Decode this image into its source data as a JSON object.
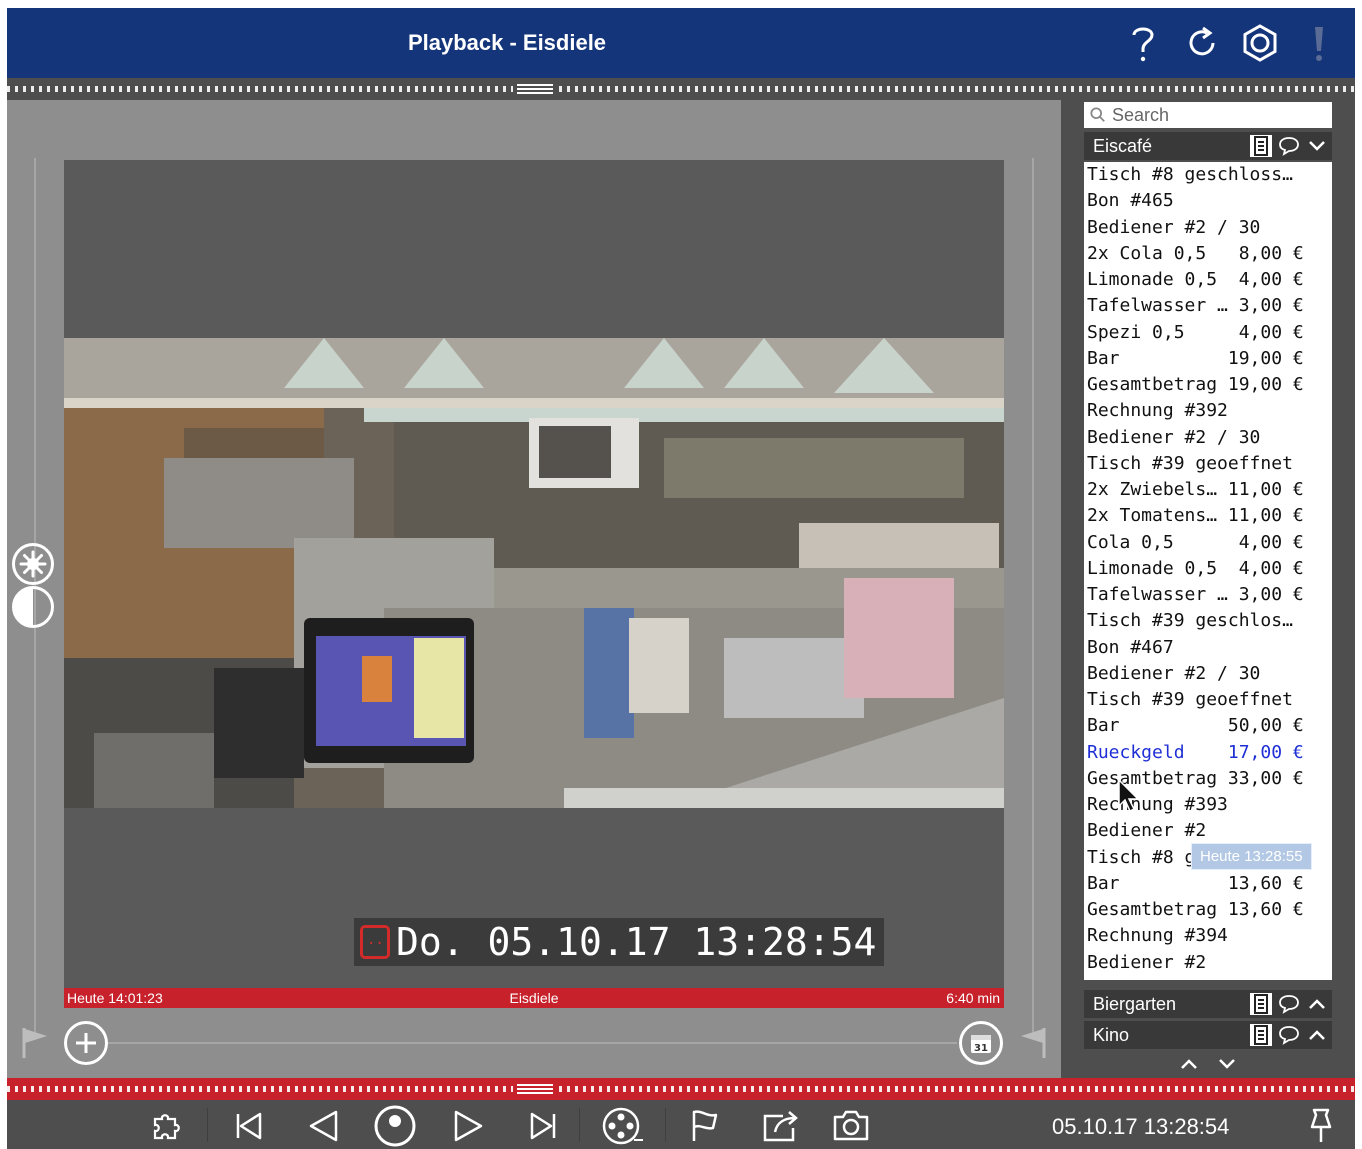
{
  "window": {
    "title": "Playback - Eisdiele"
  },
  "colors": {
    "titlebar": "#14357a",
    "accent_red": "#c7222c",
    "panel": "#4e4e4e",
    "highlight_blue": "#1f2fd6"
  },
  "titlebar_icons": [
    "help-icon",
    "refresh-icon",
    "settings-icon",
    "alert-icon"
  ],
  "video": {
    "timestamp": "Do. 05.10.17 13:28:54",
    "info_left": "Heute 14:01:23",
    "info_center": "Eisdiele",
    "info_right": "6:40 min"
  },
  "side_panel": {
    "search_placeholder": "Search",
    "sections": [
      {
        "name": "Eiscafé",
        "expanded": true
      },
      {
        "name": "Biergarten",
        "expanded": false
      },
      {
        "name": "Kino",
        "expanded": false
      }
    ],
    "receipt_lines": [
      "Tisch #8 geschloss…",
      "Bon #465",
      "Bediener #2 / 30",
      "2x Cola 0,5   8,00 €",
      "Limonade 0,5  4,00 €",
      "Tafelwasser … 3,00 €",
      "Spezi 0,5     4,00 €",
      "Bar          19,00 €",
      "Gesamtbetrag 19,00 €",
      "Rechnung #392",
      "Bediener #2 / 30",
      "Tisch #39 geoeffnet",
      "2x Zwiebels… 11,00 €",
      "2x Tomatens… 11,00 €",
      "Cola 0,5      4,00 €",
      "Limonade 0,5  4,00 €",
      "Tafelwasser … 3,00 €",
      "Tisch #39 geschlos…",
      "Bon #467",
      "Bediener #2 / 30",
      "Tisch #39 geoeffnet",
      "Bar          50,00 €",
      "Rueckgeld    17,00 €",
      "Gesamtbetrag 33,00 €",
      "Rechnung #393",
      "Bediener #2",
      "Tisch #8 geoeffnet",
      "Bar          13,60 €",
      "Gesamtbetrag 13,60 €",
      "Rechnung #394",
      "Bediener #2"
    ],
    "highlighted_line": "Rueckgeld    17,00 €",
    "tooltip": "Heute 13:28:55"
  },
  "toolbar": {
    "time": "05.10.17 13:28:54",
    "icons": [
      "puzzle-icon",
      "skip-back-icon",
      "step-back-icon",
      "record-icon",
      "play-icon",
      "skip-forward-icon",
      "film-reel-icon",
      "flag-icon",
      "export-icon",
      "camera-icon",
      "pin-icon"
    ]
  }
}
